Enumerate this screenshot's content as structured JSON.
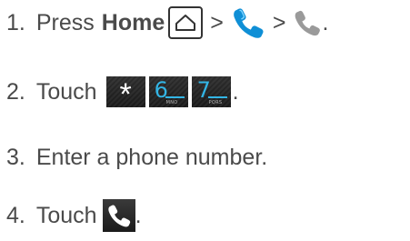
{
  "steps": [
    {
      "number": "1.",
      "text": "Press",
      "bold": "Home",
      "sep1": ">",
      "sep2": ">",
      "end": "."
    },
    {
      "number": "2.",
      "text": "Touch",
      "keys": [
        {
          "symbol": "*"
        },
        {
          "digit": "6",
          "letters": "MNO"
        },
        {
          "digit": "7",
          "letters": "PQRS"
        }
      ],
      "end": "."
    },
    {
      "number": "3.",
      "text": "Enter a phone number."
    },
    {
      "number": "4.",
      "text": "Touch",
      "end": "."
    }
  ],
  "icons": {
    "home": "home-key-icon",
    "phone_app": "phone-app-icon",
    "phone_tab": "phone-tab-icon",
    "call": "call-button-icon"
  },
  "colors": {
    "text": "#4a4a4a",
    "accent_blue": "#33b5e5",
    "phone_app_blue": "#0f8fd6",
    "phone_gray": "#9a9a9a",
    "key_background": "#222222"
  }
}
